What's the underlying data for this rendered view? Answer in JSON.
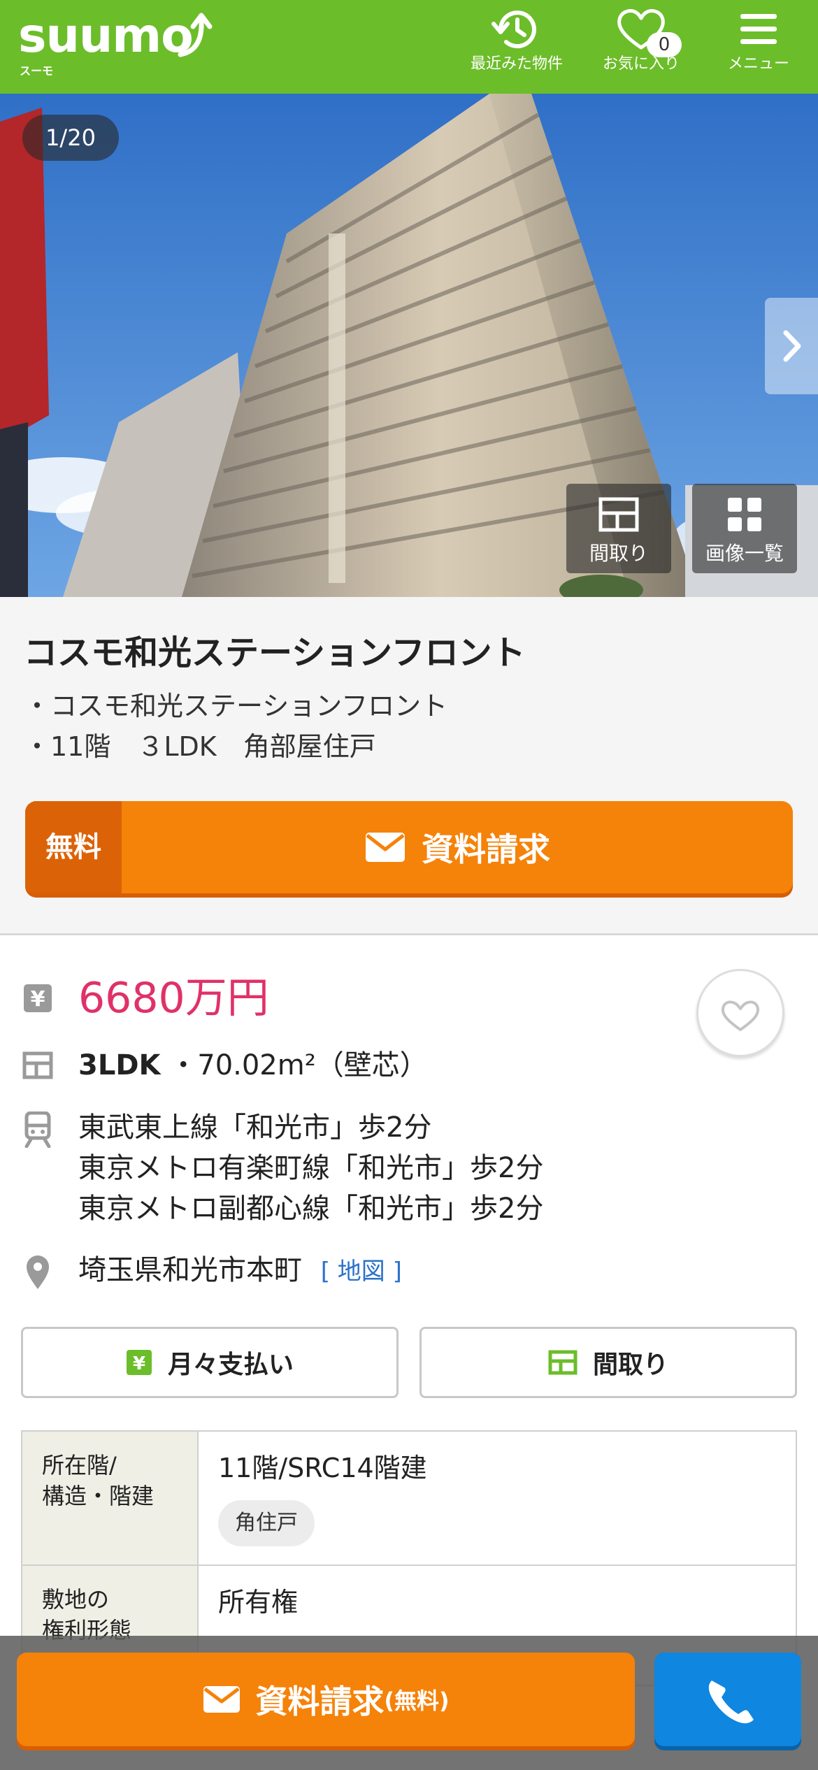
{
  "header": {
    "logo": "suumo",
    "logo_sub": "スーモ",
    "recent_label": "最近みた物件",
    "favorites_label": "お気に入り",
    "favorites_count": "0",
    "menu_label": "メニュー",
    "brand_color": "#6cbd2a"
  },
  "gallery": {
    "counter": "1/20",
    "floorplan_label": "間取り",
    "image_list_label": "画像一覧"
  },
  "property": {
    "title": "コスモ和光ステーションフロント",
    "line1": "・コスモ和光ステーションフロント",
    "line2": "・11階　３LDK　角部屋住戸"
  },
  "request": {
    "free_label": "無料",
    "label": "資料請求",
    "accent_color": "#f58209"
  },
  "details": {
    "price": "6680万円",
    "price_color": "#e03168",
    "layout": "3LDK",
    "area": "・70.02m²（壁芯）",
    "access": [
      "東武東上線「和光市」歩2分",
      "東京メトロ有楽町線「和光市」歩2分",
      "東京メトロ副都心線「和光市」歩2分"
    ],
    "address": "埼玉県和光市本町",
    "map_link": "[ 地図 ]",
    "monthly_button": "月々支払い",
    "floorplan_button": "間取り"
  },
  "specs": [
    {
      "key": "所在階/\n構造・階建",
      "value": "11階/SRC14階建",
      "tag": "角住戸"
    },
    {
      "key": "敷地の\n権利形態",
      "value": "所有権"
    }
  ],
  "bottom": {
    "request_label": "資料請求",
    "request_free": "(無料)",
    "call_color": "#0f86e0"
  }
}
